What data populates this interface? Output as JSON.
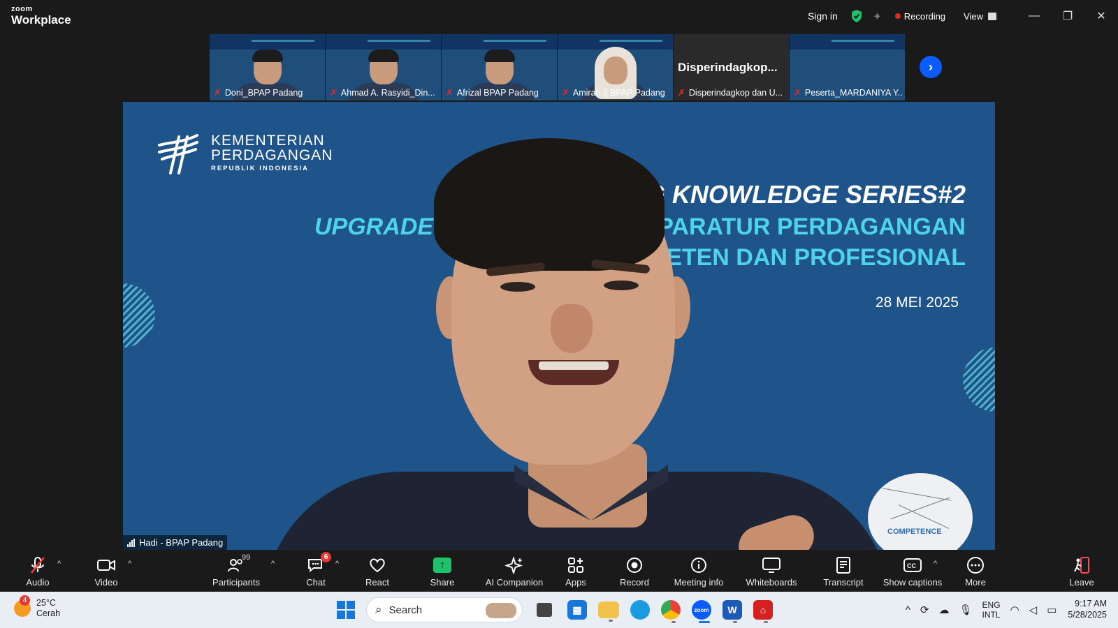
{
  "app": {
    "brand_small": "zoom",
    "brand_large": "Workplace"
  },
  "titlebar": {
    "sign_in": "Sign in",
    "recording": "Recording",
    "view": "View",
    "minimize": "—",
    "restore": "❐",
    "close": "✕"
  },
  "thumbnails": [
    {
      "name": "Doni_BPAP Padang",
      "type": "video"
    },
    {
      "name": "Ahmad A. Rasyidi_Din...",
      "type": "video"
    },
    {
      "name": "Afrizal BPAP Padang",
      "type": "video"
    },
    {
      "name": "Amirah || BPAP Padang",
      "type": "video"
    },
    {
      "name": "Disperindagkop dan U...",
      "type": "text",
      "display": "Disperindagkop..."
    },
    {
      "name": "Peserta_MARDANIYA Y...",
      "type": "video"
    }
  ],
  "slide": {
    "org_line1": "KEMENTERIAN",
    "org_line2": "PERDAGANGAN",
    "org_line3": "REPUBLIK INDONESIA",
    "series": "G KNOWLEDGE SERIES#2",
    "upgrade_left": "UPGRADE P",
    "upgrade_right": "PARATUR PERDAGANGAN",
    "line3": "ETEN DAN PROFESIONAL",
    "date": "28 MEI 2025",
    "badge_text": "COMPETENCE"
  },
  "speaker": {
    "name": "Hadi - BPAP Padang"
  },
  "toolbar": {
    "audio": "Audio",
    "video": "Video",
    "participants": "Participants",
    "participants_count": "99",
    "chat": "Chat",
    "chat_badge": "6",
    "react": "React",
    "share": "Share",
    "ai_companion": "AI Companion",
    "apps": "Apps",
    "record": "Record",
    "meeting_info": "Meeting info",
    "whiteboards": "Whiteboards",
    "transcript": "Transcript",
    "show_captions": "Show captions",
    "more": "More",
    "leave": "Leave"
  },
  "taskbar": {
    "weather_badge": "4",
    "temperature": "25°C",
    "weather_desc": "Cerah",
    "search_placeholder": "Search",
    "lang_top": "ENG",
    "lang_bottom": "INTL",
    "time": "9:17 AM",
    "date": "5/28/2025"
  },
  "colors": {
    "accent": "#0b5cff",
    "recording_dot": "#e02828",
    "share_green": "#1fc16b",
    "slide_bg": "#1e5489"
  }
}
